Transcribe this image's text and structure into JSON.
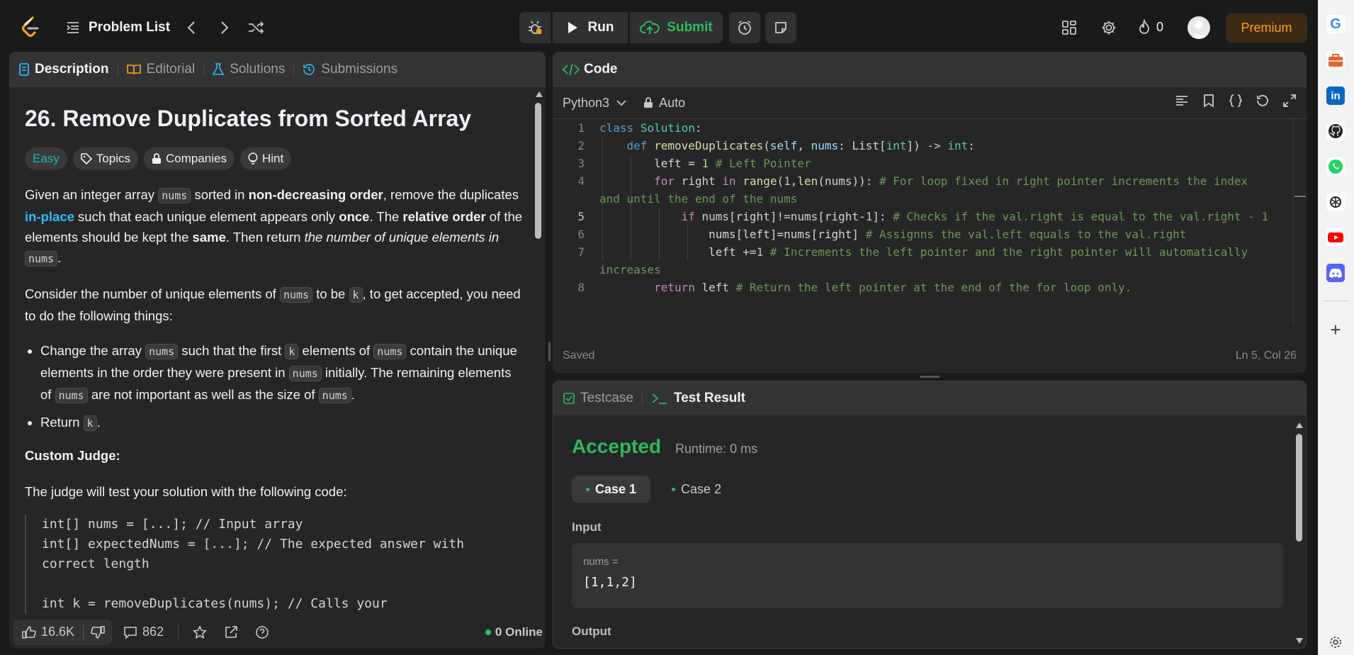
{
  "nav": {
    "problem_list": "Problem List",
    "run": "Run",
    "submit": "Submit",
    "fire_count": "0",
    "premium": "Premium"
  },
  "description": {
    "tabs": [
      "Description",
      "Editorial",
      "Solutions",
      "Submissions"
    ],
    "title": "26. Remove Duplicates from Sorted Array",
    "difficulty": "Easy",
    "chips": [
      "Topics",
      "Companies",
      "Hint"
    ],
    "p1": {
      "a": "Given an integer array ",
      "nums": "nums",
      "b": " sorted in ",
      "bold1": "non-decreasing order",
      "c": ", remove the duplicates ",
      "link": "in-place",
      "d": " such that each unique element appears only ",
      "bold2": "once",
      "e": ". The ",
      "bold3": "relative order",
      "f": " of the elements should be kept the ",
      "bold4": "same",
      "g": ". Then return ",
      "ital": "the number of unique elements in",
      "h": "."
    },
    "p2": {
      "a": "Consider the number of unique elements of ",
      "b": " to be ",
      "k": "k",
      "c": ", to get accepted, you need to do the following things:"
    },
    "bullet1": {
      "a": "Change the array ",
      "b": " such that the first ",
      "c": " elements of ",
      "d": " contain the unique elements in the order they were present in ",
      "e": " initially. The remaining elements of ",
      "f": " are not important as well as the size of ",
      "g": "."
    },
    "bullet2": {
      "a": "Return ",
      "b": "."
    },
    "custom_judge": "Custom Judge:",
    "judge_text": "The judge will test your solution with the following code:",
    "code_lines": [
      "int[] nums = [...]; // Input array",
      "int[] expectedNums = [...]; // The expected answer with",
      "correct length",
      "",
      "int k = removeDuplicates(nums); // Calls your"
    ],
    "likes": "16.6K",
    "comments": "862",
    "online": "0 Online"
  },
  "code": {
    "header": "Code",
    "language": "Python3",
    "auto": "Auto",
    "status": "Saved",
    "cursor": "Ln 5, Col 26",
    "line_numbers": [
      "1",
      "2",
      "3",
      "4",
      "5",
      "6",
      "7",
      "8"
    ]
  },
  "test": {
    "tab_testcase": "Testcase",
    "tab_result": "Test Result",
    "verdict": "Accepted",
    "runtime": "Runtime: 0 ms",
    "cases": [
      "Case 1",
      "Case 2"
    ],
    "input_label": "Input",
    "var_name": "nums =",
    "var_value": "[1,1,2]",
    "output_label": "Output"
  },
  "colors": {
    "accepted": "#2cbb5d",
    "easy": "#1cbaba",
    "premium": "#ffa116",
    "link": "#2cbbff"
  },
  "sidebar_icons": [
    "google-icon",
    "briefcase-icon",
    "linkedin-icon",
    "github-icon",
    "whatsapp-icon",
    "chatgpt-icon",
    "youtube-icon",
    "discord-icon",
    "plus-icon",
    "settings-icon"
  ]
}
